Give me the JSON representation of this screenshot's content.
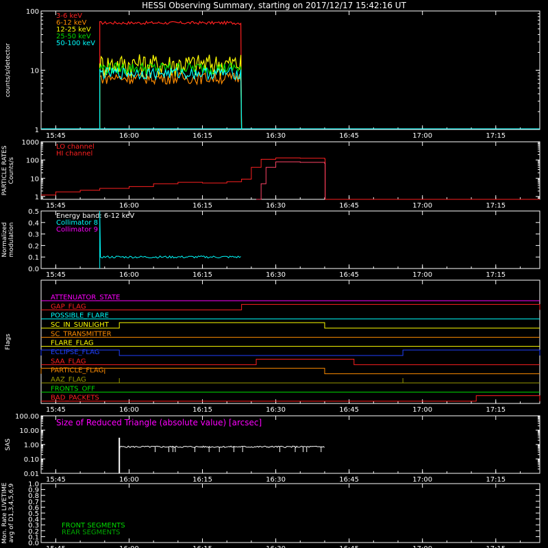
{
  "title": "HESSI Observing Summary, starting on 2017/12/17 15:42:16 UT",
  "colors": {
    "background": "#000000",
    "axis": "#ffffff",
    "red": "#ff2020",
    "orange": "#ff8c00",
    "yellow": "#ffff00",
    "green": "#00dd00",
    "cyan": "#00ffff",
    "magenta": "#ff00ff",
    "blue": "#2040ff",
    "olive": "#9a9a00"
  },
  "time_ticks": [
    "15:45",
    "16:00",
    "16:15",
    "16:30",
    "16:45",
    "17:00",
    "17:15"
  ],
  "chart_data": [
    {
      "id": "counts",
      "type": "line",
      "ylabel": "counts/s/detector",
      "yscale": "log",
      "ylim": [
        1,
        100
      ],
      "yticks": [
        "1",
        "10",
        "100"
      ],
      "legend": [
        {
          "label": "3-6 keV",
          "color": "#ff2020"
        },
        {
          "label": "6-12 keV",
          "color": "#ff8c00"
        },
        {
          "label": "12-25 keV",
          "color": "#ffff00"
        },
        {
          "label": "25-50 keV",
          "color": "#00dd00"
        },
        {
          "label": "50-100 keV",
          "color": "#00ffff"
        }
      ],
      "interval": [
        "15:54",
        "16:23"
      ],
      "levels": [
        {
          "name": "3-6 keV",
          "color": "#ff2020",
          "base": 63
        },
        {
          "name": "12-25 keV",
          "color": "#ffff00",
          "base": 13
        },
        {
          "name": "25-50 keV",
          "color": "#00dd00",
          "base": 11
        },
        {
          "name": "6-12 keV",
          "color": "#ff8c00",
          "base": 7.5
        },
        {
          "name": "50-100 keV",
          "color": "#00ffff",
          "base": 9
        }
      ]
    },
    {
      "id": "particle",
      "type": "line",
      "ylabel": "PARTICLE RATES\nCounts/s",
      "yscale": "log",
      "ylim": [
        0.7,
        1000
      ],
      "yticks": [
        "1",
        "10",
        "100",
        "1000"
      ],
      "legend": [
        {
          "label": "LO channel",
          "color": "#ff2020"
        },
        {
          "label": "HI channel",
          "color": "#ff2020"
        }
      ],
      "series": [
        {
          "name": "LO channel",
          "color": "#ff2020",
          "x": [
            "15:42",
            "15:45",
            "15:50",
            "15:54",
            "16:00",
            "16:05",
            "16:10",
            "16:15",
            "16:20",
            "16:23",
            "16:25",
            "16:27",
            "16:30",
            "16:35",
            "16:40",
            "16:40.1",
            "17:24"
          ],
          "y": [
            1.2,
            1.8,
            2.2,
            2.8,
            3.5,
            5,
            6,
            5.5,
            6.5,
            9,
            40,
            110,
            130,
            125,
            115,
            0.7,
            0.7
          ]
        },
        {
          "name": "HI channel",
          "color": "#ff4466",
          "x": [
            "16:26",
            "16:27",
            "16:28",
            "16:30",
            "16:35",
            "16:40",
            "16:40.1"
          ],
          "y": [
            0.7,
            5,
            40,
            80,
            75,
            65,
            0.7
          ]
        }
      ]
    },
    {
      "id": "modulation",
      "type": "line",
      "ylabel": "Normalized\nmodulation",
      "ylim": [
        0,
        0.5
      ],
      "yticks": [
        "0.0",
        "0.1",
        "0.2",
        "0.3",
        "0.4",
        "0.5"
      ],
      "legend": [
        {
          "label": "Energy band: 6-12 keV",
          "color": "#ffffff"
        },
        {
          "label": "Collimator 8",
          "color": "#00ffff"
        },
        {
          "label": "Collimator 9",
          "color": "#ff00ff"
        }
      ],
      "series": [
        {
          "name": "Collimator 8",
          "color": "#00ffff",
          "interval": [
            "15:54",
            "16:23"
          ],
          "level": 0.1,
          "spike": 0.5
        }
      ]
    },
    {
      "id": "flags",
      "type": "line",
      "ylabel": "Flags",
      "flags": [
        {
          "name": "ATTENUATOR_STATE",
          "color": "#ff00ff",
          "segments": []
        },
        {
          "name": "GAP_FLAG",
          "color": "#ff2020",
          "segments": [
            [
              "16:23",
              "17:24"
            ]
          ]
        },
        {
          "name": "POSSIBLE_FLARE",
          "color": "#00ffff",
          "segments": []
        },
        {
          "name": "SC_IN_SUNLIGHT",
          "color": "#ffff00",
          "segments": [
            [
              "15:58",
              "16:40"
            ]
          ]
        },
        {
          "name": "SC_TRANSMITTER",
          "color": "#ff8c00",
          "segments": []
        },
        {
          "name": "FLARE_FLAG",
          "color": "#ffff00",
          "segments": []
        },
        {
          "name": "ECLIPSE_FLAG",
          "color": "#2040ff",
          "segments": [
            [
              "15:42",
              "15:58"
            ],
            [
              "16:56",
              "17:24"
            ]
          ]
        },
        {
          "name": "SAA_FLAG",
          "color": "#ff2020",
          "segments": [
            [
              "16:26",
              "16:46"
            ]
          ]
        },
        {
          "name": "PARTICLE_FLAG",
          "color": "#ff8c00",
          "segments": [
            [
              "15:42",
              "16:40"
            ]
          ],
          "spikes": [
            "15:55"
          ]
        },
        {
          "name": "AAZ_FLAG",
          "color": "#9a9a00",
          "segments": [],
          "spikes": [
            "15:58",
            "16:56"
          ]
        },
        {
          "name": "FRONTS_OFF",
          "color": "#00dd00",
          "segments": []
        },
        {
          "name": "BAD_PACKETS",
          "color": "#ff2020",
          "segments": [
            [
              "17:11",
              "17:24"
            ]
          ]
        }
      ]
    },
    {
      "id": "sas",
      "type": "line",
      "ylabel": "SAS",
      "yscale": "log",
      "ylim": [
        0.01,
        100
      ],
      "yticks": [
        "0.01",
        "0.10",
        "1.00",
        "10.00",
        "100.00"
      ],
      "legend": [
        {
          "label": "Size of Reduced Triangle (absolute value) [arcsec]",
          "color": "#ff00ff"
        }
      ],
      "series": [
        {
          "name": "",
          "color": "#ffffff",
          "interval": [
            "15:58",
            "16:40"
          ],
          "level": 0.7,
          "start_peak": 3
        }
      ]
    },
    {
      "id": "livetime",
      "type": "line",
      "ylabel": "Mon. Rate LIVETIME\navg of D1,3,4,5,6,9",
      "ylim": [
        0,
        1.0
      ],
      "yticks": [
        "0.0",
        "0.1",
        "0.2",
        "0.3",
        "0.4",
        "0.5",
        "0.6",
        "0.7",
        "0.8",
        "0.9",
        "1.0"
      ],
      "legend": [
        {
          "label": "FRONT SEGMENTS",
          "color": "#00dd00"
        },
        {
          "label": "REAR SEGMENTS",
          "color": "#00aa00"
        }
      ],
      "series": []
    }
  ]
}
